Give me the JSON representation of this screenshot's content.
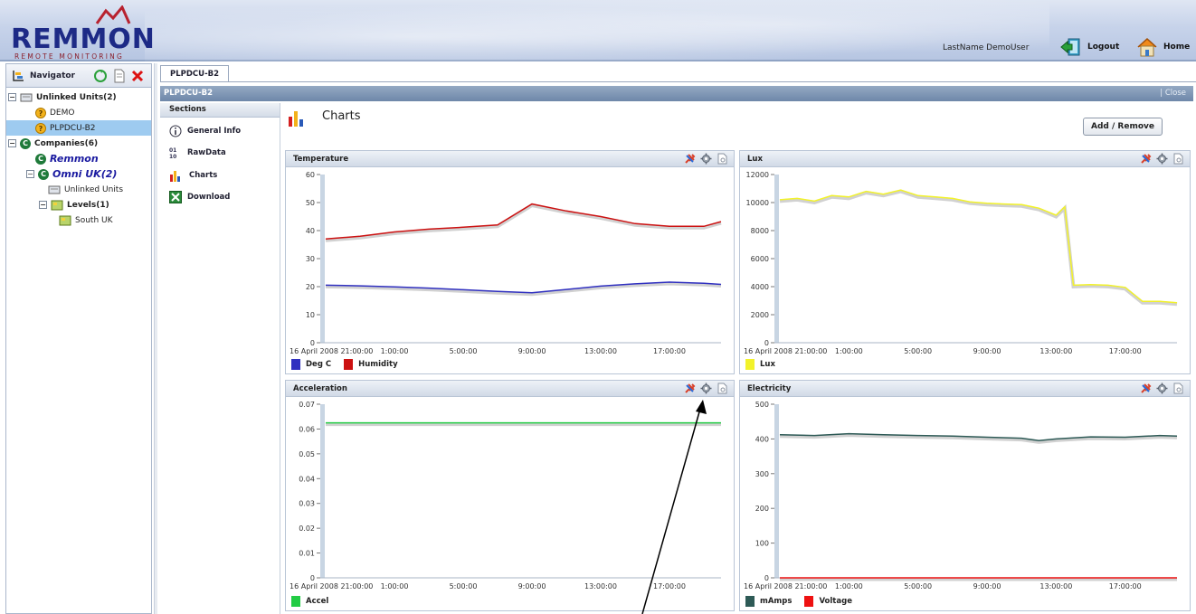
{
  "header": {
    "logo_text": "REMMON",
    "logo_subtitle": "REMOTE MONITORING",
    "user_name": "LastName DemoUser",
    "logout_label": "Logout",
    "home_label": "Home"
  },
  "navigator": {
    "title": "Navigator",
    "tree": {
      "unlinked_units": "Unlinked Units(2)",
      "demo": "DEMO",
      "plpdcu": "PLPDCU-B2",
      "companies": "Companies(6)",
      "remmon": "Remmon",
      "omni": "Omni UK(2)",
      "omni_unlinked": "Unlinked Units",
      "levels": "Levels(1)",
      "south_uk": "South UK"
    }
  },
  "tab": {
    "label": "PLPDCU-B2"
  },
  "window": {
    "title": "PLPDCU-B2",
    "close_label": "| Close"
  },
  "sections": {
    "header": "Sections",
    "items": [
      "General Info",
      "RawData",
      "Charts",
      "Download"
    ]
  },
  "page": {
    "title": "Charts",
    "add_remove_label": "Add / Remove"
  },
  "colors": {
    "deg_c": "#3030c0",
    "humidity": "#cc1111",
    "lux": "#f2f22a",
    "accel": "#22cc44",
    "mamps": "#2e5a56",
    "voltage": "#ee1111"
  },
  "icons": [
    "tools-icon",
    "gear-icon",
    "preview-icon",
    "chart-icon",
    "info-icon",
    "raw-data-icon",
    "excel-icon",
    "logout-icon",
    "home-icon",
    "refresh-icon",
    "document-icon",
    "delete-icon"
  ],
  "chart_data": [
    {
      "type": "line",
      "title": "Temperature",
      "x_ticks": [
        "16 April 2008 21:00:00",
        "1:00:00",
        "5:00:00",
        "9:00:00",
        "13:00:00",
        "17:00:00"
      ],
      "x": [
        0,
        2,
        4,
        6,
        8,
        10,
        12,
        14,
        16,
        18,
        20,
        22,
        23
      ],
      "ylim": [
        0,
        60
      ],
      "y_ticks": [
        0,
        10,
        20,
        30,
        40,
        50,
        60
      ],
      "series": [
        {
          "name": "Deg C",
          "color": "#3030c0",
          "values": [
            20.5,
            20.3,
            19.9,
            19.5,
            18.9,
            18.3,
            17.8,
            19.0,
            20.2,
            21.0,
            21.6,
            21.2,
            20.8
          ]
        },
        {
          "name": "Humidity",
          "color": "#cc1111",
          "values": [
            37,
            38,
            39.5,
            40.5,
            41.2,
            42,
            49.5,
            47,
            45,
            42.5,
            41.5,
            41.5,
            43.2
          ]
        }
      ]
    },
    {
      "type": "line",
      "title": "Lux",
      "x_ticks": [
        "16 April 2008 21:00:00",
        "1:00:00",
        "5:00:00",
        "9:00:00",
        "13:00:00",
        "17:00:00"
      ],
      "x": [
        0,
        1,
        2,
        3,
        4,
        5,
        6,
        7,
        8,
        9,
        10,
        11,
        12,
        13,
        14,
        15,
        16,
        16.5,
        17,
        18,
        19,
        20,
        21,
        22,
        23
      ],
      "ylim": [
        0,
        12000
      ],
      "y_ticks": [
        0,
        2000,
        4000,
        6000,
        8000,
        10000,
        12000
      ],
      "series": [
        {
          "name": "Lux",
          "color": "#f2f22a",
          "values": [
            10200,
            10300,
            10100,
            10500,
            10400,
            10800,
            10600,
            10900,
            10500,
            10400,
            10300,
            10050,
            9950,
            9900,
            9850,
            9600,
            9100,
            9700,
            4100,
            4150,
            4100,
            3950,
            2950,
            2950,
            2850
          ]
        }
      ]
    },
    {
      "type": "line",
      "title": "Acceleration",
      "x_ticks": [
        "16 April 2008 21:00:00",
        "1:00:00",
        "5:00:00",
        "9:00:00",
        "13:00:00",
        "17:00:00"
      ],
      "x": [
        0,
        23
      ],
      "ylim": [
        0,
        0.07
      ],
      "y_ticks": [
        0,
        0.01,
        0.02,
        0.03,
        0.04,
        0.05,
        0.06,
        0.07
      ],
      "series": [
        {
          "name": "Accel",
          "color": "#22cc44",
          "values": [
            0.0625,
            0.0625
          ]
        }
      ]
    },
    {
      "type": "line",
      "title": "Electricity",
      "x_ticks": [
        "16 April 2008 21:00:00",
        "1:00:00",
        "5:00:00",
        "9:00:00",
        "13:00:00",
        "17:00:00"
      ],
      "x": [
        0,
        2,
        4,
        6,
        8,
        10,
        12,
        14,
        15,
        16,
        18,
        20,
        22,
        23
      ],
      "ylim": [
        0,
        500
      ],
      "y_ticks": [
        0,
        100,
        200,
        300,
        400,
        500
      ],
      "series": [
        {
          "name": "mAmps",
          "color": "#2e5a56",
          "values": [
            412,
            410,
            415,
            412,
            410,
            408,
            405,
            402,
            395,
            400,
            406,
            405,
            410,
            408
          ]
        },
        {
          "name": "Voltage",
          "color": "#ee1111",
          "values": [
            0,
            0,
            0,
            0,
            0,
            0,
            0,
            0,
            0,
            0,
            0,
            0,
            0,
            0
          ]
        }
      ]
    }
  ]
}
